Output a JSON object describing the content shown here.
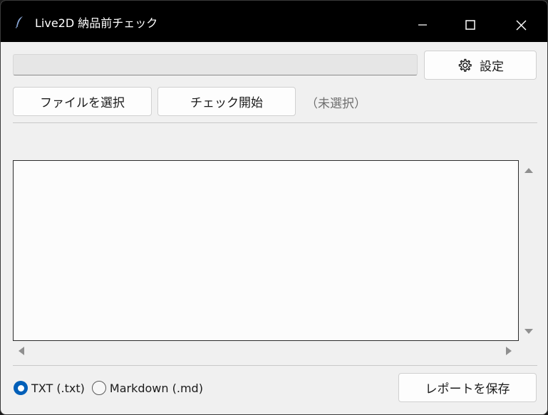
{
  "window": {
    "title": "Live2D 納品前チェック",
    "icon": "feather-icon"
  },
  "titlebar_buttons": {
    "minimize": "minimize-icon",
    "maximize": "maximize-icon",
    "close": "close-icon"
  },
  "toolbar": {
    "settings_label": "設定",
    "settings_icon": "gear-icon",
    "choose_file_label": "ファイルを選択",
    "start_check_label": "チェック開始",
    "selected_file_label": "（未選択）"
  },
  "progress": {
    "value": 0
  },
  "output": {
    "text": ""
  },
  "format": {
    "options": [
      {
        "label": "TXT (.txt)",
        "selected": true
      },
      {
        "label": "Markdown (.md)",
        "selected": false
      }
    ]
  },
  "footer": {
    "save_label": "レポートを保存"
  },
  "colors": {
    "titlebar": "#000000",
    "window_bg": "#f0f0f0",
    "accent": "#005fb8"
  }
}
